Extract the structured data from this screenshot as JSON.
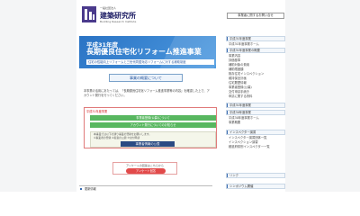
{
  "header": {
    "org_small": "一般社団法人",
    "org_name": "建築研究所",
    "org_eng": "Building Research Institute",
    "sitemap_label": "事業者に関するお問い合せ"
  },
  "banner": {
    "year": "平成31年度",
    "title": "長期優良住宅化リフォーム推進事業",
    "subtitle": "住宅の性能向上リフォームと三世代同居対応リフォームに対する補助制度"
  },
  "outline_button": "事業の概要について",
  "intro_text": "本事業の活用にあたっては、「長期優良住宅化リフォーム推進事業等の内容」を確認した上で、アカウント発行を行ってください。",
  "section": {
    "label": "平成31年度事業",
    "green_buttons": [
      "事業者登録(公募)について",
      "アカウント発行についてのお知らせ"
    ],
    "info_lines": [
      "本事業では以下の通り事業の登録をお願いします。",
      "①事業者の登録 ②提案の公募 ③交付申請",
      "事業者登録の受付開始については追ってお知らせします。",
      "ご質問は窓口までお問い合わせください。"
    ],
    "dark_button": "事業者情報の公表"
  },
  "survey": {
    "text": "アンケートの回答はこちらから",
    "button": "アンケート回答"
  },
  "news_label": "更新情報",
  "sidebar": {
    "items": [
      {
        "label": "平成31年度事業",
        "type": "h"
      },
      {
        "label": "平成31年度事業ホーム",
        "type": "s"
      },
      {
        "label": "平成31年度事業の概要",
        "type": "h"
      },
      {
        "label": "事業内容",
        "type": "s"
      },
      {
        "label": "評価基準",
        "type": "s"
      },
      {
        "label": "補助対象の費用",
        "type": "s"
      },
      {
        "label": "補助限度額",
        "type": "s"
      },
      {
        "label": "既存住宅インスペクション",
        "type": "s"
      },
      {
        "label": "維持保全計画",
        "type": "s"
      },
      {
        "label": "住宅履歴情報",
        "type": "s"
      },
      {
        "label": "事業者登録(公募)",
        "type": "s"
      },
      {
        "label": "交付申請手続き",
        "type": "s"
      },
      {
        "label": "申請に関する資料",
        "type": "s"
      },
      {
        "label": "平成31年度事業",
        "type": "h"
      },
      {
        "label": "平成30年度事業",
        "type": "h"
      },
      {
        "label": "平成30年度事業ホーム",
        "type": "s"
      },
      {
        "label": "事業概要",
        "type": "s"
      },
      {
        "label": "インスペクター講習",
        "type": "h"
      },
      {
        "label": "インスペクター講習団体一覧",
        "type": "s"
      },
      {
        "label": "インスペクション講習",
        "type": "s"
      },
      {
        "label": "都道府県別インスペクター一覧",
        "type": "s"
      },
      {
        "label": "リンク",
        "type": "h"
      },
      {
        "label": "シンポジウム開催",
        "type": "h"
      }
    ]
  }
}
